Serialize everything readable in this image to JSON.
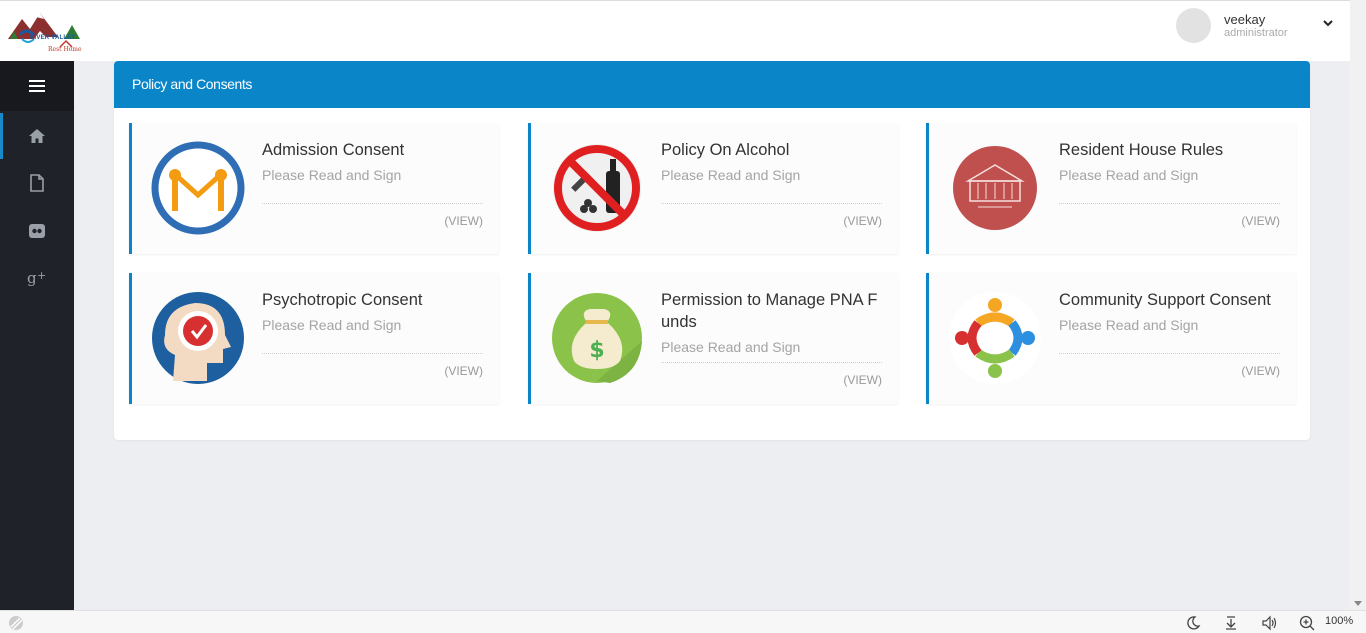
{
  "header": {
    "logo": {
      "line1": "RIVER VALLEY",
      "line2": "Rest Home"
    },
    "user": {
      "name": "veekay",
      "role": "administrator"
    }
  },
  "sidebar": {
    "items": [
      {
        "icon": "home-icon"
      },
      {
        "icon": "file-icon"
      },
      {
        "icon": "flickr-icon"
      },
      {
        "icon": "google-plus-icon"
      }
    ]
  },
  "panel": {
    "title": "Policy and Consents",
    "accent_color": "#0a86c8",
    "cards": [
      {
        "title": "Admission Consent",
        "subtitle": "Please Read and Sign",
        "action": "(VIEW)",
        "icon": "admission-consent-icon"
      },
      {
        "title": "Policy On Alcohol",
        "subtitle": "Please Read and Sign",
        "action": "(VIEW)",
        "icon": "no-alcohol-icon"
      },
      {
        "title": "Resident House Rules",
        "subtitle": "Please Read and Sign",
        "action": "(VIEW)",
        "icon": "house-rules-icon"
      },
      {
        "title": "Psychotropic Consent",
        "subtitle": "Please Read and Sign",
        "action": "(VIEW)",
        "icon": "psychotropic-icon"
      },
      {
        "title": "Permission to Manage PNA Funds",
        "subtitle": "Please Read and Sign",
        "action": "(VIEW)",
        "icon": "money-bag-icon"
      },
      {
        "title": "Community Support Consent",
        "subtitle": "Please Read and Sign",
        "action": "(VIEW)",
        "icon": "community-icon"
      }
    ]
  },
  "statusbar": {
    "zoom": "100%"
  }
}
